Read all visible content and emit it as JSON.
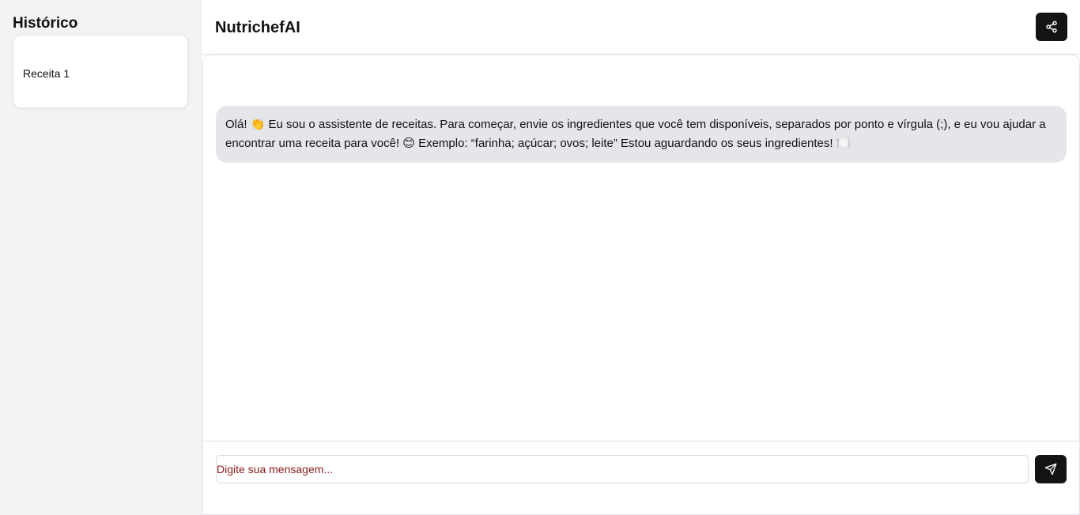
{
  "sidebar": {
    "title": "Histórico",
    "items": [
      {
        "label": "Receita 1"
      }
    ]
  },
  "header": {
    "title": "NutrichefAI",
    "share_icon": "share-icon"
  },
  "chat": {
    "messages": [
      {
        "role": "assistant",
        "text": "Olá! 👏 Eu sou o assistente de receitas. Para começar, envie os ingredientes que você tem disponíveis, separados por ponto e vírgula (;), e eu vou ajudar a encontrar uma receita para você! 😊 Exemplo: “farinha; açúcar; ovos; leite” Estou aguardando os seus ingredientes! 🍽️"
      }
    ]
  },
  "composer": {
    "placeholder": "Digite sua mensagem...",
    "value": "",
    "send_icon": "send-icon"
  },
  "colors": {
    "sidebar_bg": "#f2f3f5",
    "bubble_bg": "#e5e6ea",
    "button_bg": "#141414",
    "placeholder": "#8b1a1a"
  }
}
